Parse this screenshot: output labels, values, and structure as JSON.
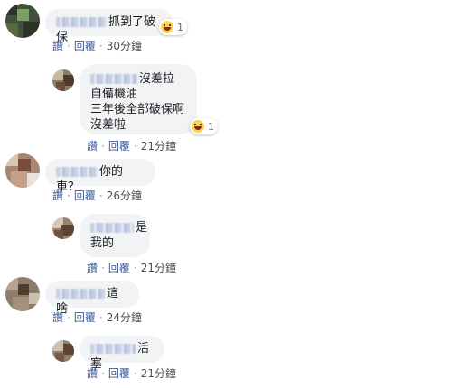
{
  "actions": {
    "like": "讚",
    "reply": "回覆",
    "sep": "·"
  },
  "comments": [
    {
      "lines": [
        "抓到了破保"
      ],
      "time": "30分鐘",
      "reaction_count": "1",
      "reaction_icon": "haha-icon"
    },
    {
      "lines": [
        "沒差拉",
        "自備機油",
        "三年後全部破保啊",
        "沒差啦"
      ],
      "time": "21分鐘",
      "reaction_count": "1",
      "reaction_icon": "haha-icon"
    },
    {
      "lines": [
        "你的車？"
      ],
      "time": "26分鐘"
    },
    {
      "lines": [
        "是",
        "我的"
      ],
      "time": "21分鐘"
    },
    {
      "lines": [
        "這啥"
      ],
      "time": "24分鐘"
    },
    {
      "lines": [
        "活塞"
      ],
      "time": "21分鐘"
    }
  ],
  "colors": {
    "bubble": "#f2f3f5",
    "link": "#385898",
    "meta": "#4b4f56"
  }
}
